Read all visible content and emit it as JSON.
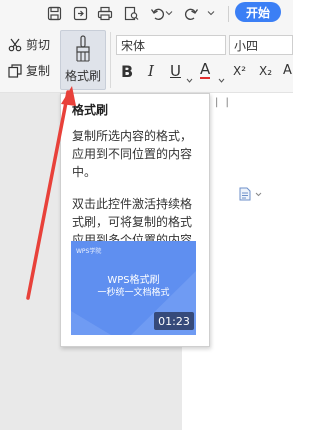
{
  "toolbar": {
    "start_tab": "开始",
    "cut_label": "剪切",
    "copy_label": "复制",
    "format_painter_label": "格式刷",
    "font_name": "宋体",
    "font_size": "小四",
    "bold": "B",
    "italic": "I",
    "underline": "U",
    "font_color": "A",
    "superscript": "X²",
    "subscript": "X₂",
    "clear_format": "A"
  },
  "tooltip": {
    "title": "格式刷",
    "paragraph1": "复制所选内容的格式，应用到不同位置的内容中。",
    "paragraph2": "双击此控件激活持续格式刷，可将复制的格式应用到多个位置的内容中。",
    "video": {
      "brand": "WPS学院",
      "title_line1": "WPS格式刷",
      "title_line2": "一秒统一文档格式",
      "duration": "01:23"
    }
  },
  "colors": {
    "accent": "#3b7ff5",
    "video_bg": "#5f8ff0",
    "arrow": "#e8413a",
    "font_color_red": "#e02d2d"
  },
  "icons": [
    "save-icon",
    "export-icon",
    "print-icon",
    "print-preview-icon",
    "undo-icon",
    "redo-icon",
    "dropdown-icon",
    "scissors-icon",
    "copy-icon",
    "brush-icon",
    "document-icon"
  ]
}
